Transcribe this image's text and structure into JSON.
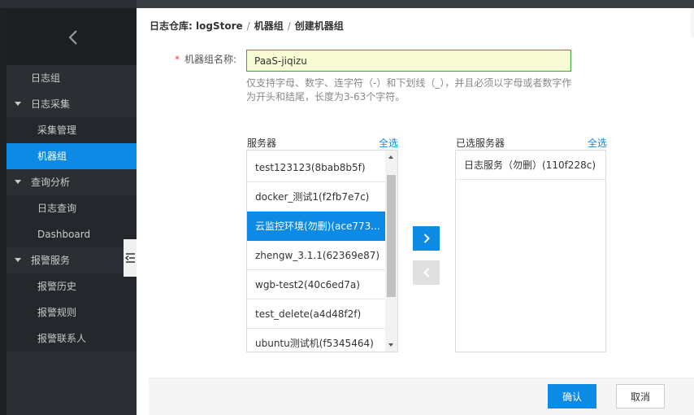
{
  "breadcrumb": {
    "root": "日志仓库:",
    "store": "logStore",
    "group": "机器组",
    "current": "创建机器组"
  },
  "sidebar": {
    "items": [
      {
        "label": "日志组",
        "type": "lvl1"
      },
      {
        "label": "日志采集",
        "type": "group"
      },
      {
        "label": "采集管理",
        "type": "lvl2"
      },
      {
        "label": "机器组",
        "type": "lvl2",
        "active": true
      },
      {
        "label": "查询分析",
        "type": "group"
      },
      {
        "label": "日志查询",
        "type": "lvl2"
      },
      {
        "label": "Dashboard",
        "type": "lvl2"
      },
      {
        "label": "报警服务",
        "type": "group"
      },
      {
        "label": "报警历史",
        "type": "lvl2"
      },
      {
        "label": "报警规则",
        "type": "lvl2"
      },
      {
        "label": "报警联系人",
        "type": "lvl2"
      }
    ]
  },
  "form": {
    "name_label": "机器组名称:",
    "required_mark": "*",
    "name_value": "PaaS-jiqizu",
    "hint": "仅支持字母、数字、连字符（-）和下划线（_），并且必须以字母或者数字作为开头和结尾，长度为3-63个字符。"
  },
  "servers": {
    "title": "服务器",
    "select_all": "全选",
    "items": [
      {
        "label": "test123123(8bab8b5f)"
      },
      {
        "label": "docker_测试1(f2fb7e7c)"
      },
      {
        "label": "云监控环境(勿删)(ace773...",
        "selected": true
      },
      {
        "label": "zhengw_3.1.1(62369e87)"
      },
      {
        "label": "wgb-test2(40c6ed7a)"
      },
      {
        "label": "test_delete(a4d48f2f)"
      },
      {
        "label": "ubuntu测试机(f5345464)"
      }
    ]
  },
  "selected_servers": {
    "title": "已选服务器",
    "select_all": "全选",
    "items": [
      {
        "label": "日志服务（勿删）(110f228c)"
      }
    ]
  },
  "footer": {
    "confirm": "确认",
    "cancel": "取消"
  },
  "colors": {
    "accent": "#0d8ae5",
    "sidebar_bg": "#2b2e33",
    "input_bg": "#f8fdd3",
    "input_border": "#3da34a"
  }
}
